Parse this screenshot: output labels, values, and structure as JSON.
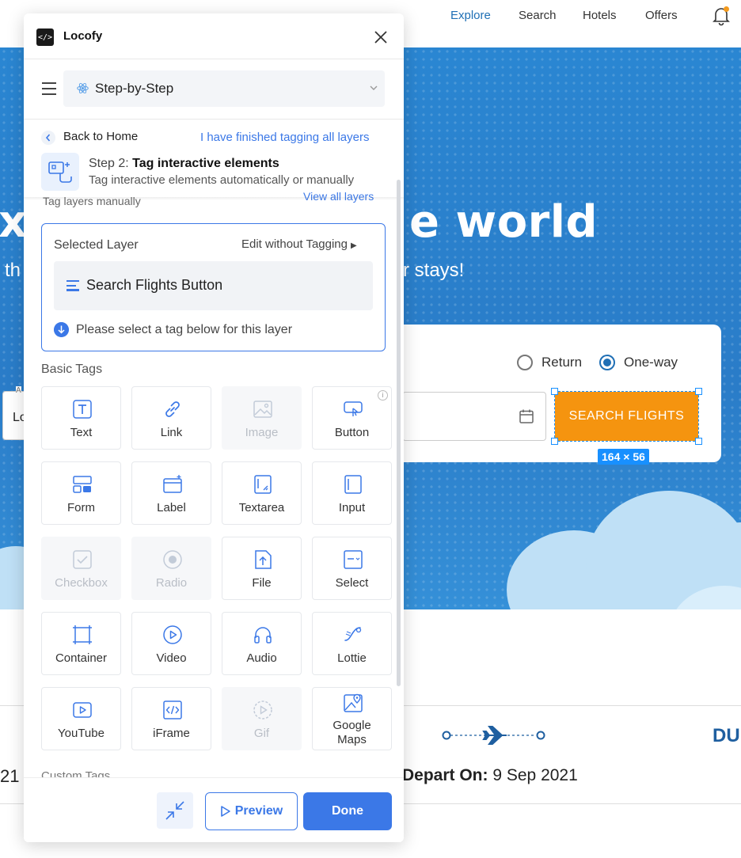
{
  "site": {
    "nav": [
      "Explore",
      "Search",
      "Hotels",
      "Offers"
    ],
    "hero_title": "xplore the world",
    "hero_sub": "th                                                  r stays!",
    "trip_type": {
      "return_label": "Return",
      "oneway_label": "One-way"
    },
    "left_field_text": "Lo",
    "left_field_tiny": "A",
    "search_button": "SEARCH FLIGHTS",
    "size_badge": "164 × 56",
    "flight_left": "21",
    "depart_label": "Depart On:",
    "depart_value": "9 Sep 2021",
    "dest_code": "DU"
  },
  "panel": {
    "app_title": "Locofy",
    "mode": "Step-by-Step",
    "back_label": "Back to Home",
    "finished_link": "I have finished tagging all layers",
    "step_prefix": "Step 2:",
    "step_title": "Tag interactive elements",
    "step_desc": "Tag interactive elements automatically or manually",
    "tag_manual": "Tag layers manually",
    "view_all": "View all layers",
    "selected_layer_title": "Selected Layer",
    "edit_without_tagging": "Edit without Tagging",
    "layer_name": "Search Flights Button",
    "hint": "Please select a tag below for this layer",
    "basic_tags_heading": "Basic Tags",
    "tags": [
      {
        "label": "Text",
        "icon": "text-icon",
        "disabled": false
      },
      {
        "label": "Link",
        "icon": "link-icon",
        "disabled": false
      },
      {
        "label": "Image",
        "icon": "image-icon",
        "disabled": true
      },
      {
        "label": "Button",
        "icon": "button-icon",
        "disabled": false
      },
      {
        "label": "Form",
        "icon": "form-icon",
        "disabled": false
      },
      {
        "label": "Label",
        "icon": "label-icon",
        "disabled": false
      },
      {
        "label": "Textarea",
        "icon": "textarea-icon",
        "disabled": false
      },
      {
        "label": "Input",
        "icon": "input-icon",
        "disabled": false
      },
      {
        "label": "Checkbox",
        "icon": "checkbox-icon",
        "disabled": true
      },
      {
        "label": "Radio",
        "icon": "radio-icon",
        "disabled": true
      },
      {
        "label": "File",
        "icon": "file-icon",
        "disabled": false
      },
      {
        "label": "Select",
        "icon": "select-icon",
        "disabled": false
      },
      {
        "label": "Container",
        "icon": "container-icon",
        "disabled": false
      },
      {
        "label": "Video",
        "icon": "video-icon",
        "disabled": false
      },
      {
        "label": "Audio",
        "icon": "audio-icon",
        "disabled": false
      },
      {
        "label": "Lottie",
        "icon": "lottie-icon",
        "disabled": false
      },
      {
        "label": "YouTube",
        "icon": "youtube-icon",
        "disabled": false
      },
      {
        "label": "iFrame",
        "icon": "iframe-icon",
        "disabled": false
      },
      {
        "label": "Gif",
        "icon": "gif-icon",
        "disabled": true
      },
      {
        "label": "Google Maps",
        "icon": "google-maps-icon",
        "disabled": false
      }
    ],
    "custom_tags_heading": "Custom Tags",
    "preview_label": "Preview",
    "done_label": "Done"
  },
  "colors": {
    "accent": "#3b78e7",
    "hero_blue": "#2a7cc8",
    "search_orange": "#f5940f",
    "selection_blue": "#1890ff"
  }
}
